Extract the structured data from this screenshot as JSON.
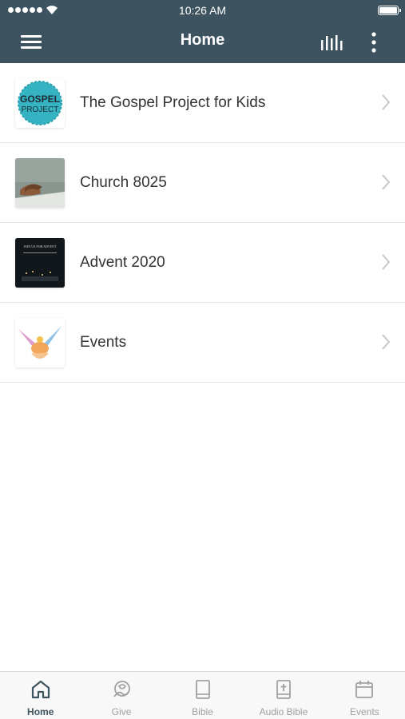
{
  "status_bar": {
    "time": "10:26 AM"
  },
  "nav": {
    "title": "Home"
  },
  "items": [
    {
      "label": "The Gospel Project for Kids",
      "thumb_text_line1": "GOSPEL",
      "thumb_text_line2": "PROJECT"
    },
    {
      "label": "Church 8025"
    },
    {
      "label": "Advent 2020",
      "thumb_text_line1": "JOIN US FOR ADVENT"
    },
    {
      "label": "Events"
    }
  ],
  "tabs": [
    {
      "label": "Home",
      "icon": "home-icon",
      "active": true
    },
    {
      "label": "Give",
      "icon": "give-icon",
      "active": false
    },
    {
      "label": "Bible",
      "icon": "bible-icon",
      "active": false
    },
    {
      "label": "Audio Bible",
      "icon": "audio-bible-icon",
      "active": false
    },
    {
      "label": "Events",
      "icon": "events-icon",
      "active": false
    }
  ],
  "colors": {
    "header": "#3d5460",
    "tab_active": "#3d5460",
    "tab_inactive": "#a0a0a0",
    "gospel_teal": "#35b3c2"
  }
}
